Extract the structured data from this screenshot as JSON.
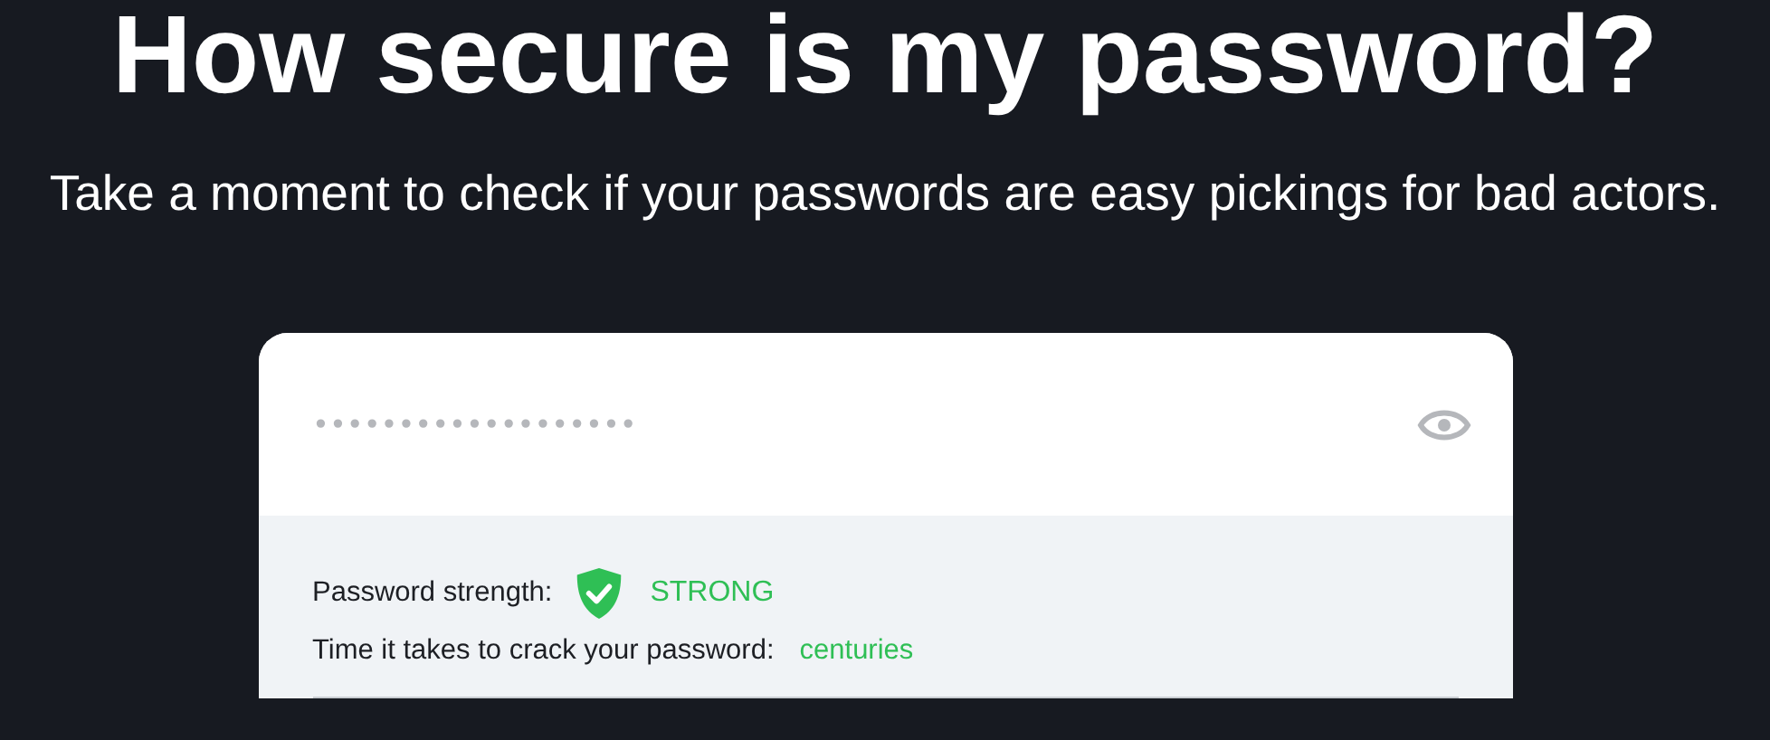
{
  "heading": "How secure is my password?",
  "subtitle": "Take a moment to check if your passwords are easy pickings for bad actors.",
  "password_field": {
    "value": "•••••••••••••••••••",
    "revealed": false
  },
  "strength": {
    "label": "Password strength:",
    "value": "STRONG",
    "kind": "strong"
  },
  "crack_time": {
    "label": "Time it takes to crack your password:",
    "value": "centuries"
  }
}
